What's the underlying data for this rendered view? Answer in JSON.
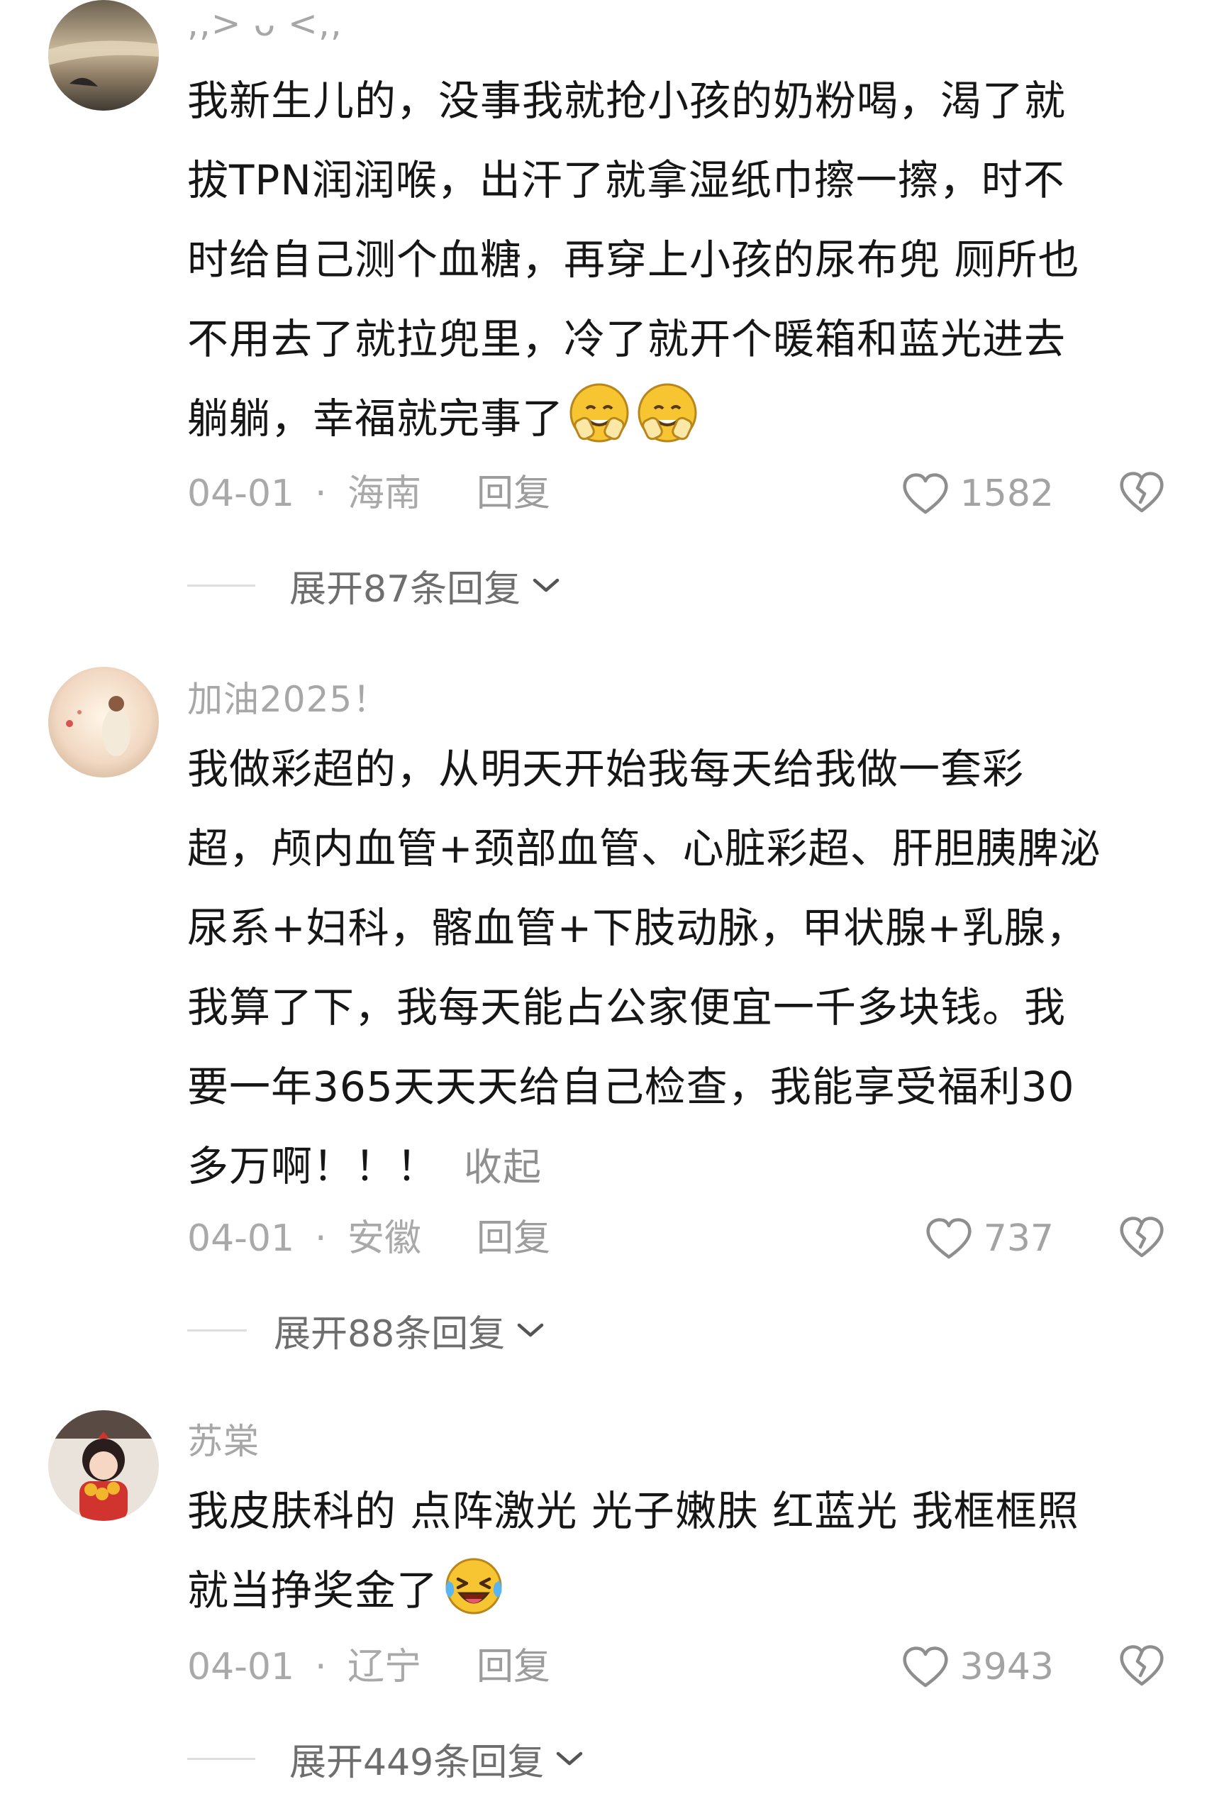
{
  "comments": [
    {
      "username": ",,> ᴗ <,,",
      "lines": [
        "我新生儿的，没事我就抢小孩的奶粉喝，渴了就",
        "拔TPN润润喉，出汗了就拿湿纸巾擦一擦，时不",
        "时给自己测个血糖，再穿上小孩的尿布兜 厕所也",
        "不用去了就拉兜里，冷了就开个暖箱和蓝光进去",
        "躺躺，幸福就完事了"
      ],
      "emoji_icons": [
        "hugging-face-icon",
        "hugging-face-icon"
      ],
      "date": "04-01",
      "separator": "·",
      "region": "海南",
      "reply_label": "回复",
      "likes": "1582",
      "expand_text": "展开87条回复"
    },
    {
      "username": "加油2025！",
      "lines": [
        "我做彩超的，从明天开始我每天给我做一套彩",
        "超，颅内血管+颈部血管、心脏彩超、肝胆胰脾泌",
        "尿系+妇科，髂血管+下肢动脉，甲状腺+乳腺，",
        "我算了下，我每天能占公家便宜一千多块钱。我",
        "要一年365天天天给自己检查，我能享受福利30",
        "多万啊！！！"
      ],
      "collapse_label": "收起",
      "date": "04-01",
      "separator": "·",
      "region": "安徽",
      "reply_label": "回复",
      "likes": "737",
      "expand_text": "展开88条回复"
    },
    {
      "username": "苏棠",
      "lines": [
        "我皮肤科的 点阵激光 光子嫩肤 红蓝光 我框框照",
        "就当挣奖金了"
      ],
      "emoji_icons": [
        "laughing-crying-face-icon"
      ],
      "date": "04-01",
      "separator": "·",
      "region": "辽宁",
      "reply_label": "回复",
      "likes": "3943",
      "expand_text": "展开449条回复"
    }
  ],
  "colors": {
    "text": "#161616",
    "muted": "#a9a9a9",
    "emoji_yellow": "#f7c531"
  }
}
